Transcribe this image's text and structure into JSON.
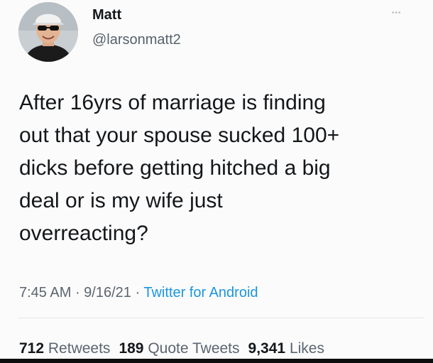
{
  "author": {
    "name": "Matt",
    "handle": "@larsonmatt2",
    "avatar_icon": "profile-photo"
  },
  "tweet": {
    "text": "After 16yrs of marriage is finding\nout that your spouse sucked 100+\ndicks before getting hitched a big\ndeal or is my wife just\noverreacting?",
    "time": "7:45 AM",
    "separator": " · ",
    "date": "9/16/21",
    "source": "Twitter for Android"
  },
  "stats": {
    "retweets_count": "712",
    "retweets_label": "Retweets",
    "quotes_count": "189",
    "quotes_label": "Quote Tweets",
    "likes_count": "9,341",
    "likes_label": "Likes"
  },
  "colors": {
    "text": "#14171a",
    "secondary": "#5b6570",
    "link": "#1b95e0"
  }
}
